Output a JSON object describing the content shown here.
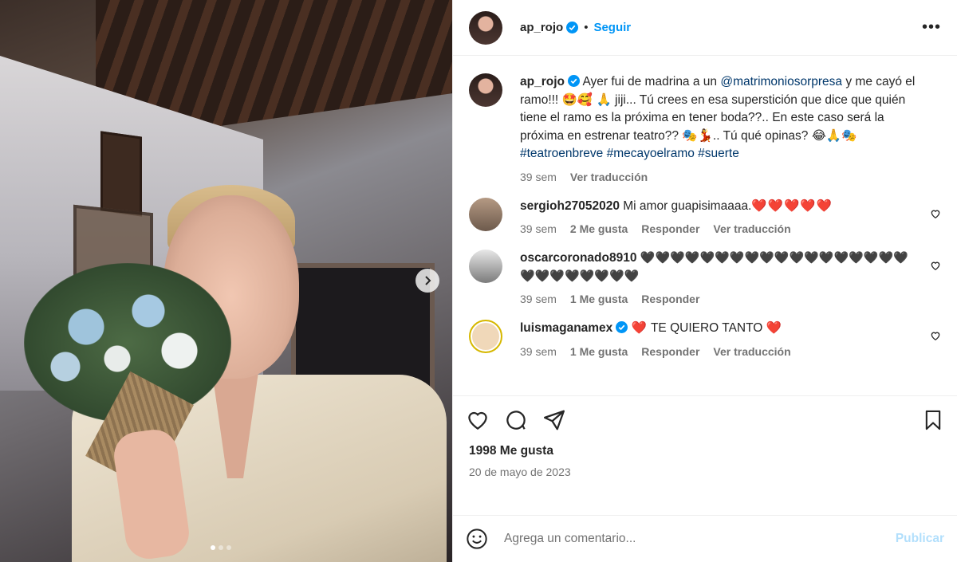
{
  "photo": {
    "carousel_dots": 3,
    "active_dot": 0
  },
  "header": {
    "username": "ap_rojo",
    "separator": "•",
    "follow_label": "Seguir",
    "more_label": "•••"
  },
  "caption": {
    "username": "ap_rojo",
    "text_1": "Ayer fui de madrina a un",
    "mention": "@matrimoniosorpresa",
    "text_2": "y me cayó el ramo!!! 🤩🥰 🙏 jiji... Tú crees en esa superstición que dice que quién tiene el ramo es la próxima en tener boda??.. En este caso será la próxima en estrenar teatro?? 🎭💃.. Tú qué opinas? 😂🙏🎭",
    "hashtags": "#teatroenbreve #mecayoelramo #suerte",
    "time": "39 sem",
    "translate": "Ver traducción"
  },
  "comments": [
    {
      "username": "sergioh27052020",
      "text": "Mi amor guapisimaaaa.",
      "hearts": "❤️❤️❤️❤️❤️",
      "time": "39 sem",
      "likes": "2 Me gusta",
      "reply": "Responder",
      "translate": "Ver traducción"
    },
    {
      "username": "oscarcoronado8910",
      "text": "",
      "hearts": "🖤🖤🖤🖤🖤🖤🖤🖤🖤🖤🖤🖤🖤🖤🖤🖤🖤🖤🖤🖤🖤🖤🖤🖤🖤🖤",
      "time": "39 sem",
      "likes": "1 Me gusta",
      "reply": "Responder"
    },
    {
      "username": "luismaganamex",
      "text": "TE QUIERO TANTO",
      "heart_before": "❤️",
      "heart_after": "❤️",
      "time": "39 sem",
      "likes": "1 Me gusta",
      "reply": "Responder",
      "translate": "Ver traducción"
    }
  ],
  "stats": {
    "likes": "1998 Me gusta",
    "date": "20 de mayo de 2023"
  },
  "comment_box": {
    "placeholder": "Agrega un comentario...",
    "post_label": "Publicar"
  },
  "colors": {
    "link_blue": "#0095f6",
    "mention": "#00376b",
    "muted": "#737373",
    "heart_red": "#e0172a"
  }
}
